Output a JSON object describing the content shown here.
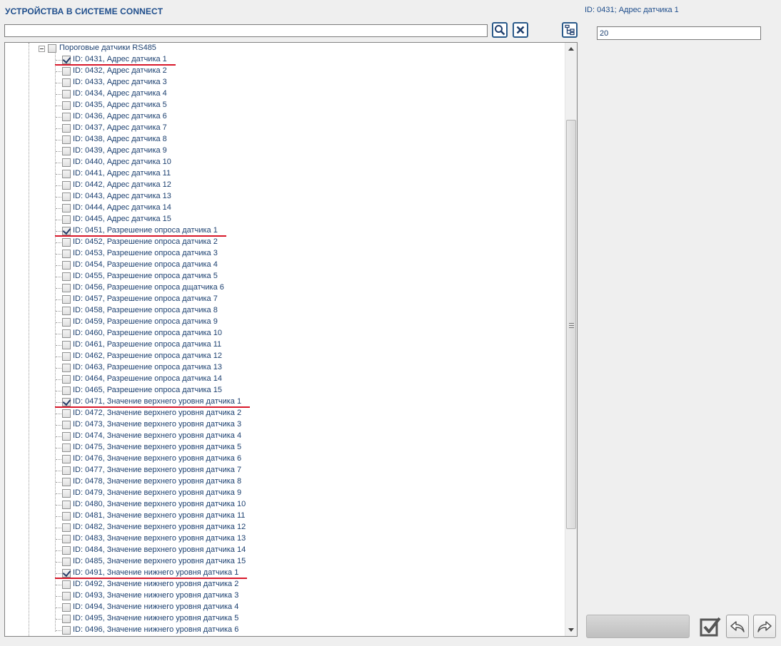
{
  "header": {
    "title": "УСТРОЙСТВА В СИСТЕМЕ CONNECT"
  },
  "search": {
    "value": "",
    "placeholder": ""
  },
  "toolbar": {
    "search_icon": "magnifier-icon",
    "clear_icon": "close-icon",
    "tree_icon": "tree-structure-icon"
  },
  "tree": {
    "parent": {
      "label": "Пороговые датчики RS485",
      "checked": false,
      "expanded": true
    },
    "items": [
      {
        "label": "ID: 0431, Адрес датчика 1",
        "checked": true
      },
      {
        "label": "ID: 0432, Адрес датчика 2",
        "checked": false
      },
      {
        "label": "ID: 0433, Адрес датчика 3",
        "checked": false
      },
      {
        "label": "ID: 0434, Адрес датчика 4",
        "checked": false
      },
      {
        "label": "ID: 0435, Адрес датчика 5",
        "checked": false
      },
      {
        "label": "ID: 0436, Адрес датчика 6",
        "checked": false
      },
      {
        "label": "ID: 0437, Адрес датчика 7",
        "checked": false
      },
      {
        "label": "ID: 0438, Адрес датчика 8",
        "checked": false
      },
      {
        "label": "ID: 0439, Адрес датчика 9",
        "checked": false
      },
      {
        "label": "ID: 0440, Адрес датчика 10",
        "checked": false
      },
      {
        "label": "ID: 0441, Адрес датчика 11",
        "checked": false
      },
      {
        "label": "ID: 0442, Адрес датчика 12",
        "checked": false
      },
      {
        "label": "ID: 0443, Адрес датчика 13",
        "checked": false
      },
      {
        "label": "ID: 0444, Адрес датчика 14",
        "checked": false
      },
      {
        "label": "ID: 0445, Адрес датчика 15",
        "checked": false
      },
      {
        "label": "ID: 0451, Разрешение опроса датчика 1",
        "checked": true
      },
      {
        "label": "ID: 0452, Разрешение опроса датчика 2",
        "checked": false
      },
      {
        "label": "ID: 0453, Разрешение опроса датчика 3",
        "checked": false
      },
      {
        "label": "ID: 0454, Разрешение опроса датчика 4",
        "checked": false
      },
      {
        "label": "ID: 0455, Разрешение опроса датчика 5",
        "checked": false
      },
      {
        "label": "ID: 0456, Разрешение опроса дщатчика 6",
        "checked": false
      },
      {
        "label": "ID: 0457, Разрешение опроса датчика 7",
        "checked": false
      },
      {
        "label": "ID: 0458, Разрешение опроса датчика 8",
        "checked": false
      },
      {
        "label": "ID: 0459, Разрешение опроса датчика 9",
        "checked": false
      },
      {
        "label": "ID: 0460, Разрешение опроса датчика 10",
        "checked": false
      },
      {
        "label": "ID: 0461, Разрешение опроса датчика 11",
        "checked": false
      },
      {
        "label": "ID: 0462, Разрешение опроса датчика 12",
        "checked": false
      },
      {
        "label": "ID: 0463, Разрешение опроса датчика 13",
        "checked": false
      },
      {
        "label": "ID: 0464, Разрешение опроса датчика 14",
        "checked": false
      },
      {
        "label": "ID: 0465, Разрешение опроса датчика 15",
        "checked": false
      },
      {
        "label": "ID: 0471, Значение верхнего уровня датчика 1",
        "checked": true
      },
      {
        "label": "ID: 0472, Значение верхнего уровня датчика 2",
        "checked": false
      },
      {
        "label": "ID: 0473, Значение верхнего уровня датчика 3",
        "checked": false
      },
      {
        "label": "ID: 0474, Значение верхнего уровня датчика 4",
        "checked": false
      },
      {
        "label": "ID: 0475, Значение верхнего уровня датчика 5",
        "checked": false
      },
      {
        "label": "ID: 0476, Значение верхнего уровня датчика 6",
        "checked": false
      },
      {
        "label": "ID: 0477, Значение верхнего уровня датчика 7",
        "checked": false
      },
      {
        "label": "ID: 0478, Значение верхнего уровня датчика 8",
        "checked": false
      },
      {
        "label": "ID: 0479, Значение верхнего уровня датчика 9",
        "checked": false
      },
      {
        "label": "ID: 0480, Значение верхнего уровня датчика 10",
        "checked": false
      },
      {
        "label": "ID: 0481, Значение верхнего уровня датчика 11",
        "checked": false
      },
      {
        "label": "ID: 0482, Значение верхнего уровня датчика 12",
        "checked": false
      },
      {
        "label": "ID: 0483, Значение верхнего уровня датчика 13",
        "checked": false
      },
      {
        "label": "ID: 0484, Значение верхнего уровня датчика 14",
        "checked": false
      },
      {
        "label": "ID: 0485, Значение верхнего уровня датчика 15",
        "checked": false
      },
      {
        "label": "ID: 0491, Значение нижнего уровня датчика 1",
        "checked": true
      },
      {
        "label": "ID: 0492, Значение нижнего уровня датчика 2",
        "checked": false
      },
      {
        "label": "ID: 0493, Значение нижнего уровня датчика 3",
        "checked": false
      },
      {
        "label": "ID: 0494, Значение нижнего уровня датчика 4",
        "checked": false
      },
      {
        "label": "ID: 0495, Значение нижнего уровня датчика 5",
        "checked": false
      },
      {
        "label": "ID: 0496, Значение нижнего уровня датчика 6",
        "checked": false
      }
    ]
  },
  "detail": {
    "title": "ID: 0431; Адрес датчика 1",
    "value": "20"
  },
  "actions": {
    "apply_icon": "checkmark-icon",
    "undo_icon": "undo-arrow-icon",
    "redo_icon": "redo-arrow-icon"
  },
  "colors": {
    "accent": "#1f4e8c",
    "highlight_underline": "#d8182a"
  }
}
